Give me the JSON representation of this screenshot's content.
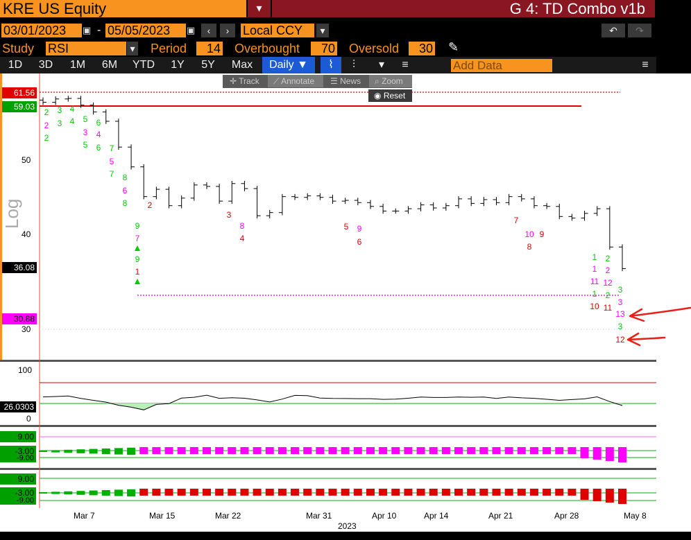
{
  "header": {
    "ticker": "KRE US Equity",
    "menu_glyph": "▾",
    "function_title": "G 4: TD Combo v1b"
  },
  "date_range": {
    "start": "03/01/2023",
    "separator": "-",
    "end": "05/05/2023",
    "currency": "Local CCY"
  },
  "study": {
    "label": "Study",
    "name": "RSI",
    "period_label": "Period",
    "period": "14",
    "overbought_label": "Overbought",
    "overbought": "70",
    "oversold_label": "Oversold",
    "oversold": "30"
  },
  "timeframes": [
    "1D",
    "3D",
    "1M",
    "6M",
    "YTD",
    "1Y",
    "5Y",
    "Max"
  ],
  "frequency": "Daily ▼",
  "add_data_placeholder": "Add Data",
  "popup": {
    "items": [
      "Track",
      "Annotate",
      "News",
      "Zoom"
    ],
    "reset": "Reset"
  },
  "price_panel": {
    "scale_label": "Log",
    "badges": [
      {
        "value": "61.56",
        "color": "#e00000"
      },
      {
        "value": "59.03",
        "color": "#00a000"
      },
      {
        "value": "36.08",
        "color": "#000000"
      },
      {
        "value": "30.88",
        "color": "#ff00ff"
      }
    ],
    "ticks": [
      "50",
      "40",
      "30"
    ]
  },
  "rsi_panel": {
    "ticks": [
      "100",
      "0"
    ],
    "current": "26.0303"
  },
  "td_panel_1": {
    "labels": [
      "9.00",
      "-3.00",
      "-9.00"
    ]
  },
  "td_panel_2": {
    "labels": [
      "9.00",
      "-3.00",
      "-9.00"
    ]
  },
  "x_axis": {
    "dates": [
      "Mar 7",
      "Mar 15",
      "Mar 22",
      "Mar 31",
      "Apr 10",
      "Apr 14",
      "Apr 21",
      "Apr 28",
      "May 8"
    ],
    "year": "2023"
  },
  "chart_data": {
    "type": "ohlc",
    "instrument": "KRE US Equity",
    "frequency": "Daily",
    "scale": "log",
    "ylim": [
      26,
      63
    ],
    "x": [
      "03/01",
      "03/02",
      "03/03",
      "03/06",
      "03/07",
      "03/08",
      "03/09",
      "03/10",
      "03/13",
      "03/14",
      "03/15",
      "03/16",
      "03/17",
      "03/20",
      "03/21",
      "03/22",
      "03/23",
      "03/24",
      "03/27",
      "03/28",
      "03/29",
      "03/30",
      "03/31",
      "04/03",
      "04/04",
      "04/05",
      "04/06",
      "04/10",
      "04/11",
      "04/12",
      "04/13",
      "04/14",
      "04/17",
      "04/18",
      "04/19",
      "04/20",
      "04/21",
      "04/24",
      "04/25",
      "04/26",
      "04/27",
      "04/28",
      "05/01",
      "05/02",
      "05/03",
      "05/04",
      "05/05"
    ],
    "close": [
      59.5,
      60.1,
      60.2,
      59.0,
      57.8,
      56.2,
      52.0,
      49.0,
      44.8,
      45.8,
      43.6,
      44.6,
      46.4,
      46.2,
      44.2,
      46.6,
      45.9,
      42.3,
      42.7,
      44.8,
      44.7,
      44.9,
      44.7,
      44.2,
      44.3,
      44.0,
      43.5,
      42.9,
      42.9,
      43.2,
      43.7,
      43.3,
      43.6,
      44.5,
      43.9,
      44.4,
      44.0,
      44.8,
      44.5,
      43.6,
      43.5,
      42.2,
      42.0,
      42.6,
      43.2,
      38.5,
      36.08
    ],
    "overbought_level": 61.56,
    "reference_level": 59.03,
    "support_level": 30.88,
    "rsi": {
      "period": 14,
      "overbought": 70,
      "oversold": 30,
      "last": 26.0303
    }
  }
}
